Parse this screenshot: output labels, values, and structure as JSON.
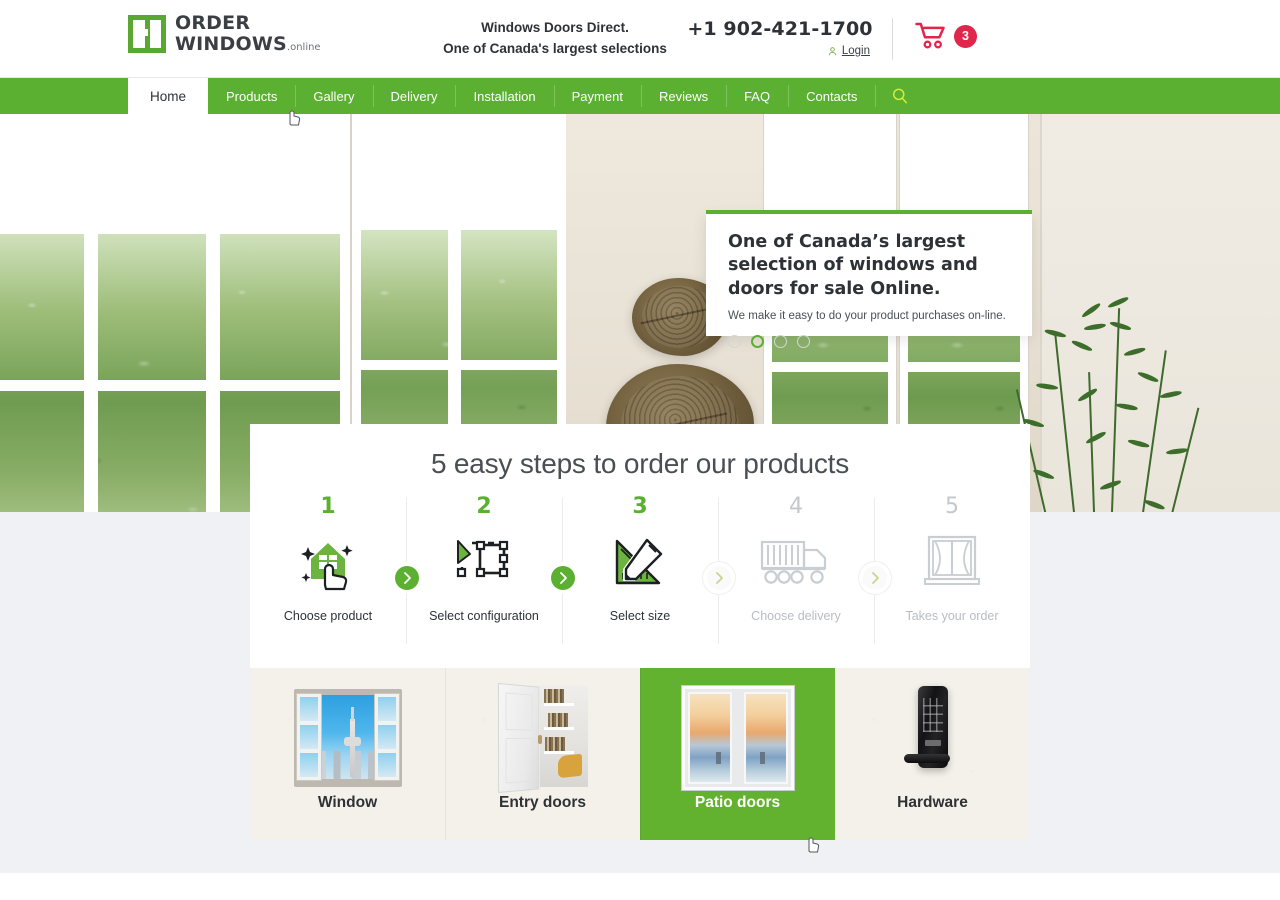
{
  "header": {
    "logo": {
      "line1": "ORDER",
      "line2": "WINDOWS",
      "suffix": ".online",
      "icon": "window-logo-icon"
    },
    "tagline_line1": "Windows Doors Direct.",
    "tagline_line2": "One of Canada's largest selections",
    "phone": "+1 902-421-1700",
    "login_label": "Login",
    "login_icon": "user-icon",
    "cart_icon": "shopping-cart-icon",
    "cart_count": "3",
    "cart_color": "#e0264a"
  },
  "nav": {
    "accent": "#5cb031",
    "items": [
      {
        "label": "Home",
        "active": true
      },
      {
        "label": "Products",
        "active": false
      },
      {
        "label": "Gallery",
        "active": false
      },
      {
        "label": "Delivery",
        "active": false
      },
      {
        "label": "Installation",
        "active": false
      },
      {
        "label": "Payment",
        "active": false
      },
      {
        "label": "Reviews",
        "active": false
      },
      {
        "label": "FAQ",
        "active": false
      },
      {
        "label": "Contacts",
        "active": false
      }
    ],
    "search_icon": "search-icon"
  },
  "hero": {
    "callout": {
      "title": "One of Canada’s largest selection of windows and doors for sale Online.",
      "subtitle": "We make it easy to do your product purchases on-line.",
      "dots_total": 4,
      "active_dot": 2,
      "accent": "#5cb031"
    }
  },
  "steps_section": {
    "title": "5 easy steps to order our products",
    "active_color": "#5cb031",
    "dim_color": "#c4c8cc",
    "steps": [
      {
        "num": "1",
        "label": "Choose product",
        "icon": "hand-pointer-house-icon",
        "active": true
      },
      {
        "num": "2",
        "label": "Select configuration",
        "icon": "selection-nodes-icon",
        "active": true
      },
      {
        "num": "3",
        "label": "Select size",
        "icon": "ruler-pencil-icon",
        "active": true
      },
      {
        "num": "4",
        "label": "Choose delivery",
        "icon": "delivery-truck-icon",
        "active": false
      },
      {
        "num": "5",
        "label": "Takes your order",
        "icon": "window-curtain-icon",
        "active": false
      }
    ],
    "connectors": [
      {
        "icon": "chevron-right-icon",
        "active": true
      },
      {
        "icon": "chevron-right-icon",
        "active": true
      },
      {
        "icon": "chevron-right-icon",
        "active": false
      },
      {
        "icon": "chevron-right-icon",
        "active": false
      }
    ]
  },
  "categories": {
    "active_color": "#62b22f",
    "items": [
      {
        "label": "Window",
        "image": "open-window-cityscape-photo",
        "active": false
      },
      {
        "label": "Entry doors",
        "image": "open-entry-door-interior-photo",
        "active": false
      },
      {
        "label": "Patio doors",
        "image": "sliding-patio-door-sunset-photo",
        "active": true
      },
      {
        "label": "Hardware",
        "image": "smart-door-lock-photo",
        "active": false
      }
    ]
  }
}
